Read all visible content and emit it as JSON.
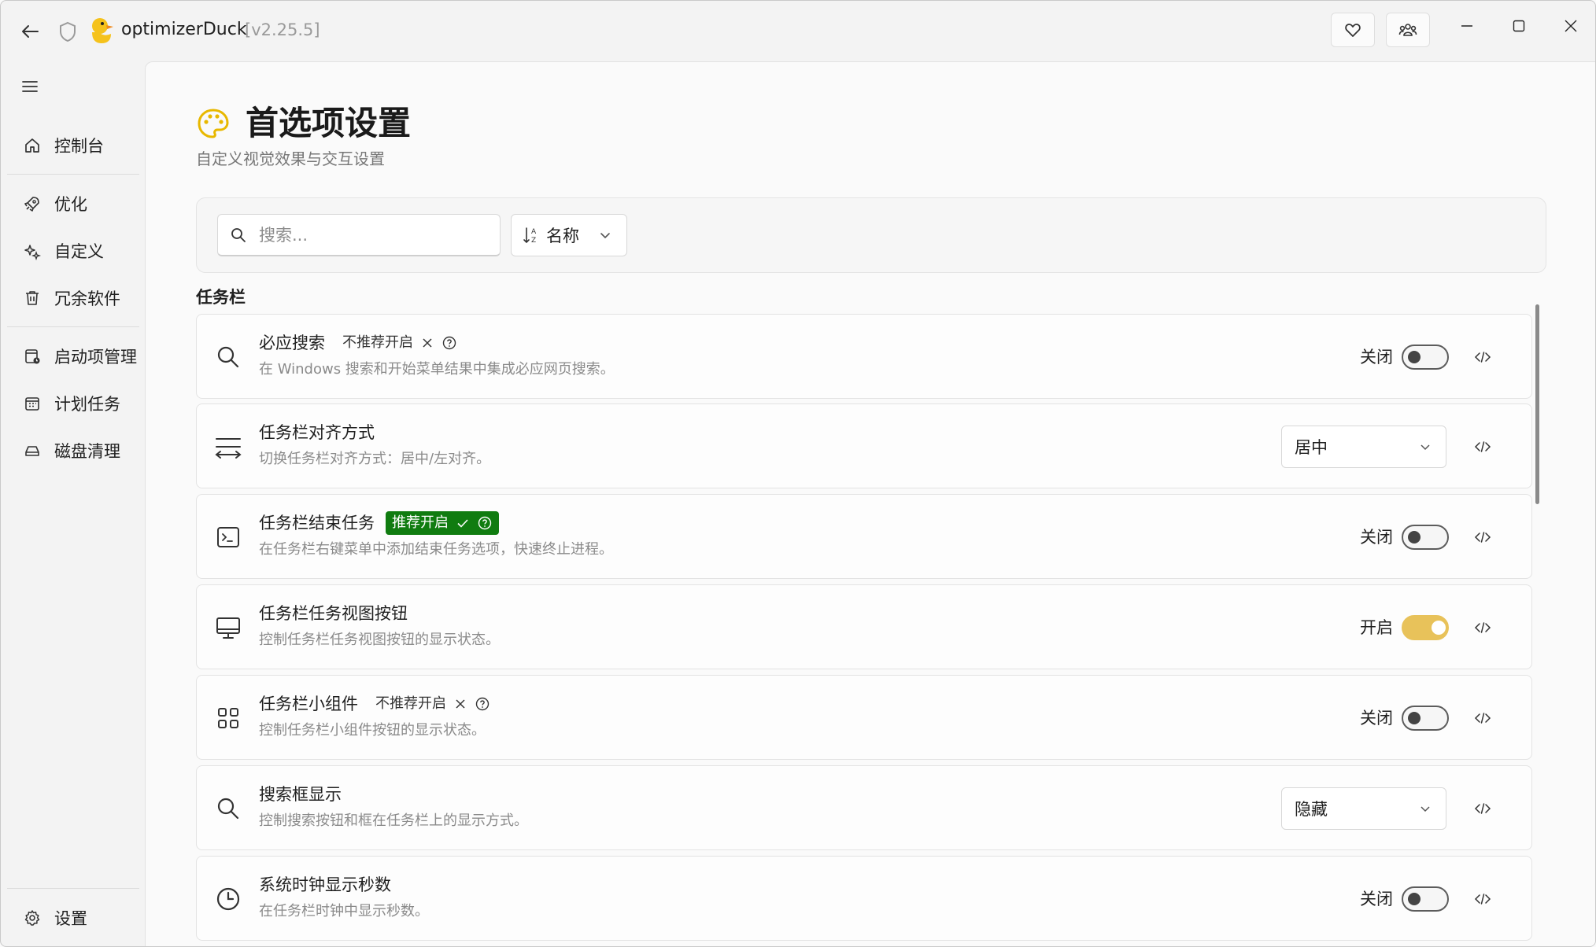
{
  "app": {
    "title": "optimizerDuck",
    "version": "[v2.25.5]"
  },
  "sidebar": {
    "items": [
      {
        "label": "控制台",
        "icon": "home-icon"
      },
      {
        "label": "优化",
        "icon": "rocket-icon"
      },
      {
        "label": "自定义",
        "icon": "sparkle-icon"
      },
      {
        "label": "冗余软件",
        "icon": "trash-icon"
      },
      {
        "label": "启动项管理",
        "icon": "startup-icon"
      },
      {
        "label": "计划任务",
        "icon": "calendar-icon"
      },
      {
        "label": "磁盘清理",
        "icon": "drive-icon"
      }
    ],
    "settings_label": "设置"
  },
  "page": {
    "title": "首选项设置",
    "subtitle": "自定义视觉效果与交互设置"
  },
  "filter": {
    "search_placeholder": "搜索...",
    "sort_label": "名称"
  },
  "section": {
    "title": "任务栏"
  },
  "rows": [
    {
      "title": "必应搜索",
      "badge": "不推荐开启",
      "badge_type": "plain",
      "desc": "在 Windows 搜索和开始菜单结果中集成必应网页搜索。",
      "control": "toggle",
      "state": "关闭",
      "on": false,
      "icon": "search-icon"
    },
    {
      "title": "任务栏对齐方式",
      "badge": "",
      "badge_type": "",
      "desc": "切换任务栏对齐方式：居中/左对齐。",
      "control": "dropdown",
      "value": "居中",
      "icon": "align-icon"
    },
    {
      "title": "任务栏结束任务",
      "badge": "推荐开启",
      "badge_type": "green",
      "desc": "在任务栏右键菜单中添加结束任务选项，快速终止进程。",
      "control": "toggle",
      "state": "关闭",
      "on": false,
      "icon": "terminal-icon"
    },
    {
      "title": "任务栏任务视图按钮",
      "badge": "",
      "badge_type": "",
      "desc": "控制任务栏任务视图按钮的显示状态。",
      "control": "toggle",
      "state": "开启",
      "on": true,
      "icon": "monitor-icon"
    },
    {
      "title": "任务栏小组件",
      "badge": "不推荐开启",
      "badge_type": "plain",
      "desc": "控制任务栏小组件按钮的显示状态。",
      "control": "toggle",
      "state": "关闭",
      "on": false,
      "icon": "widgets-icon"
    },
    {
      "title": "搜索框显示",
      "badge": "",
      "badge_type": "",
      "desc": "控制搜索按钮和框在任务栏上的显示方式。",
      "control": "dropdown",
      "value": "隐藏",
      "icon": "search-icon"
    },
    {
      "title": "系统时钟显示秒数",
      "badge": "",
      "badge_type": "",
      "desc": "在任务栏时钟中显示秒数。",
      "control": "toggle",
      "state": "关闭",
      "on": false,
      "icon": "clock-icon"
    }
  ],
  "colors": {
    "accent": "#e8c25a",
    "recommend_badge": "#107c10"
  }
}
